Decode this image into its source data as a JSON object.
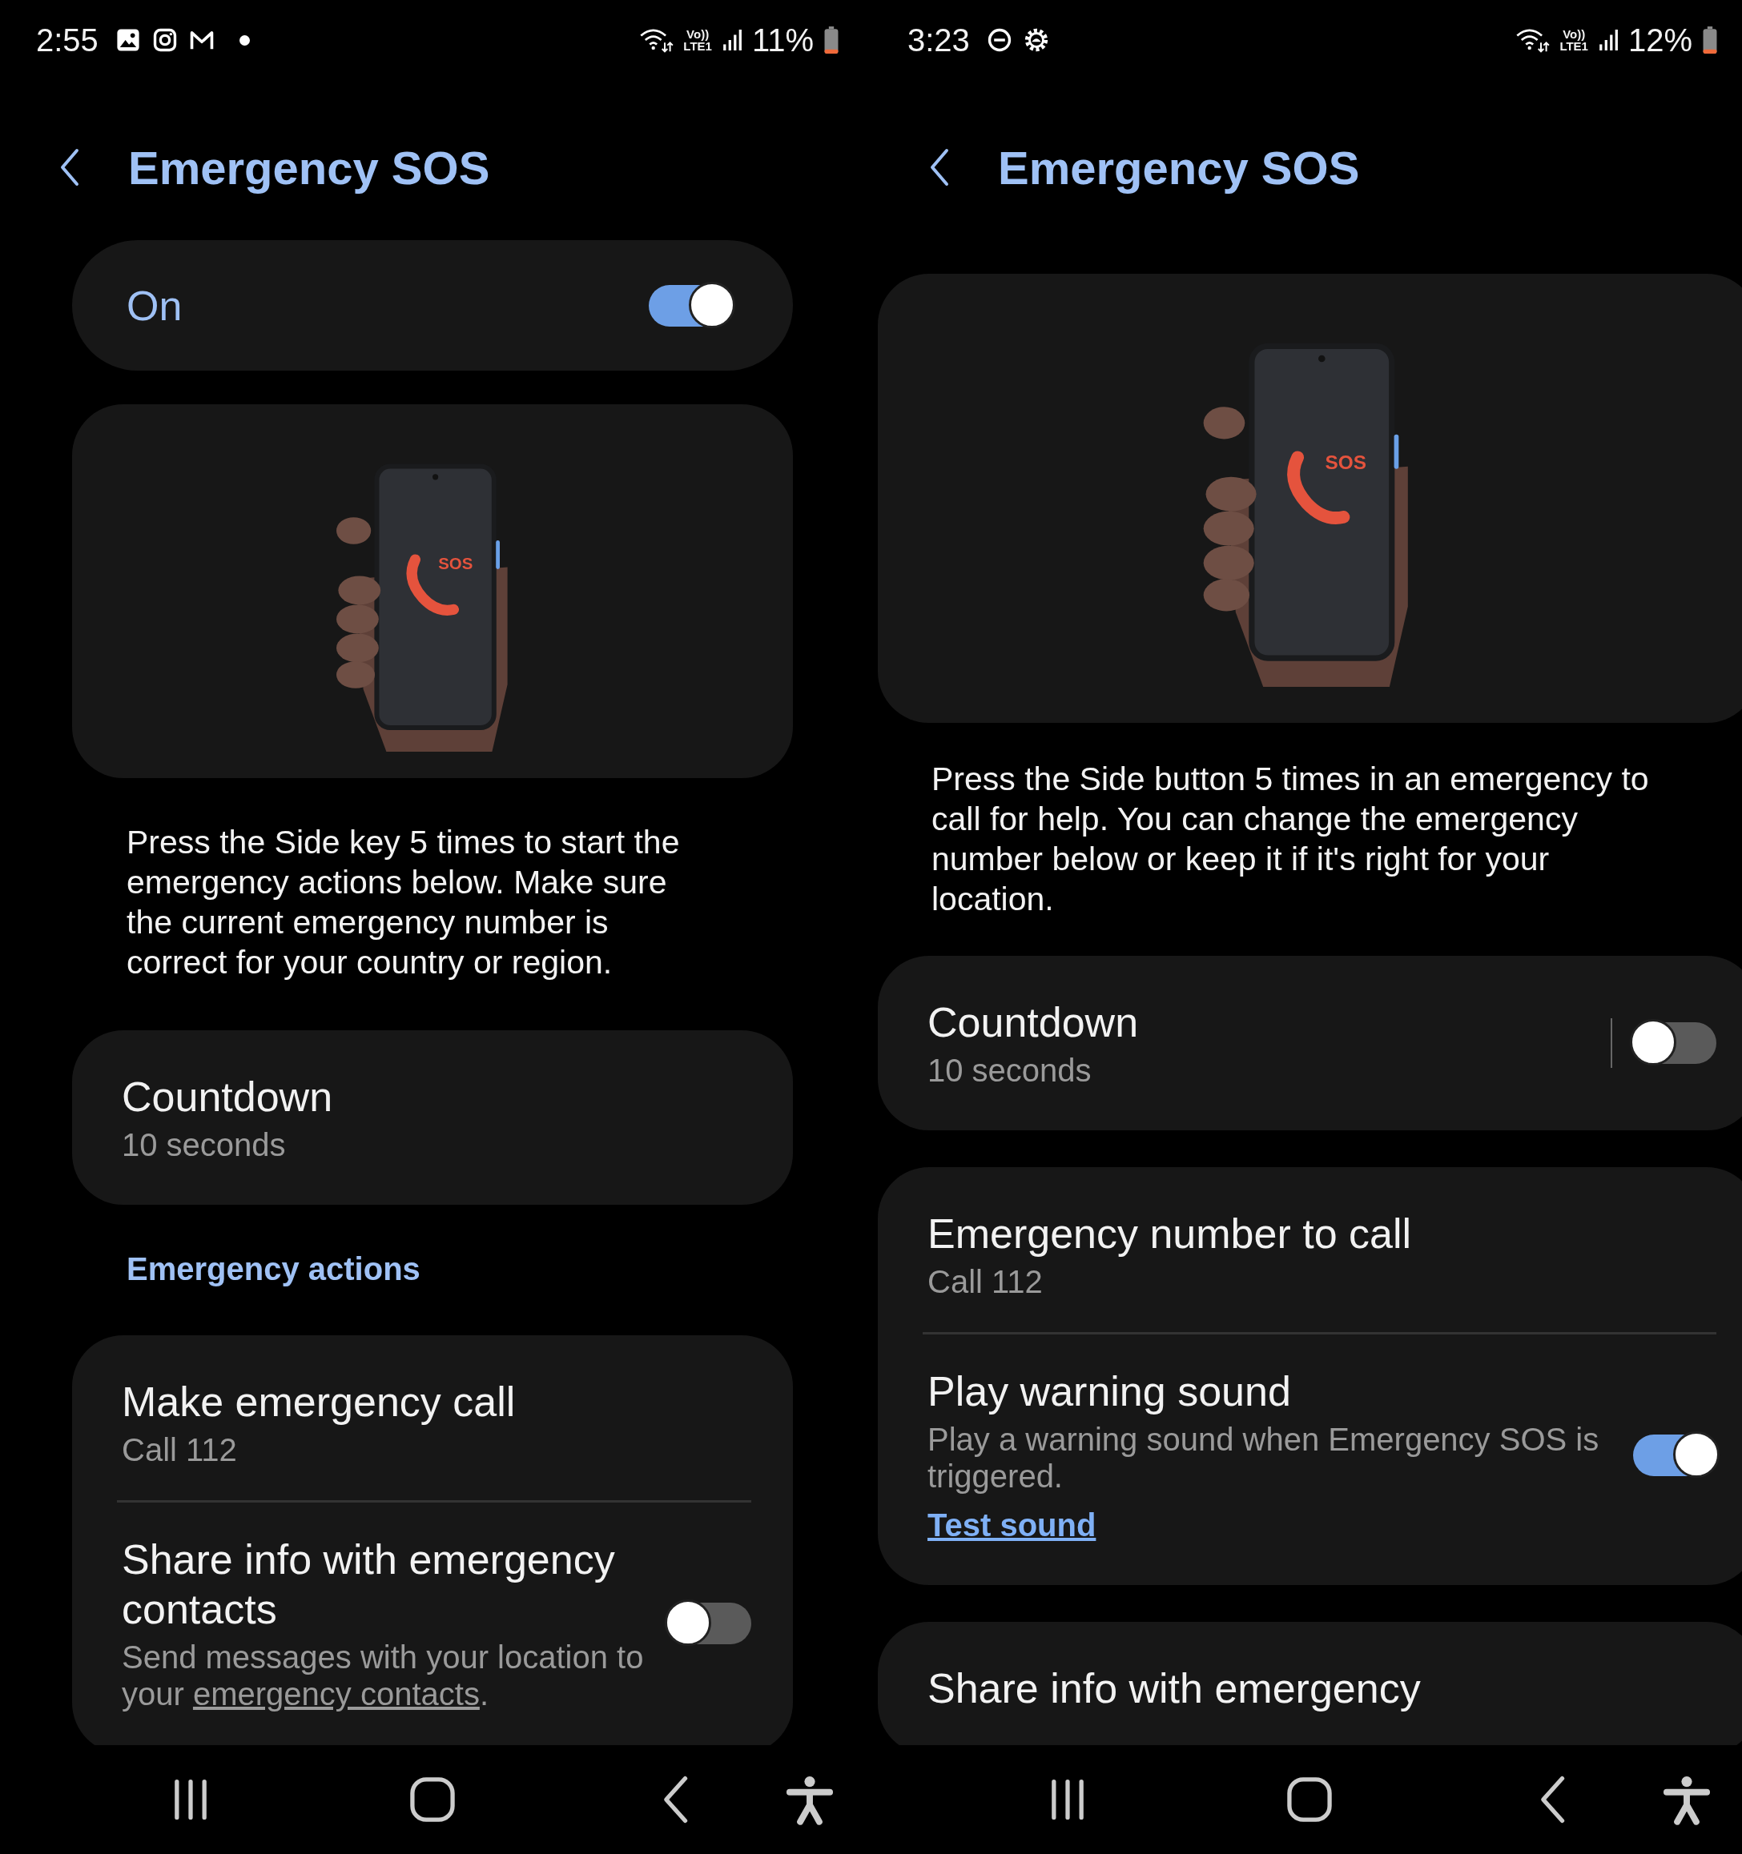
{
  "panels": [
    {
      "status_bar": {
        "time": "2:55",
        "notifications": [
          {
            "kind": "gallery"
          },
          {
            "kind": "instagram"
          },
          {
            "kind": "mail"
          },
          {
            "kind": "dot"
          }
        ],
        "volte": "Vo))",
        "network": "LTE1",
        "battery": "11%"
      },
      "title": "Emergency SOS",
      "blocks": [
        {
          "kind": "master_switch",
          "label": "On",
          "on": true
        },
        {
          "kind": "illustration",
          "badge": "SOS"
        },
        {
          "kind": "description",
          "text": "Press the Side key 5 times to start the emergency actions below. Make sure the current emergency number is correct for your country or region."
        },
        {
          "kind": "card",
          "rows": [
            {
              "title": "Countdown",
              "subtitle": "10 seconds"
            }
          ]
        },
        {
          "kind": "section_header",
          "text": "Emergency actions"
        },
        {
          "kind": "card",
          "rows": [
            {
              "title": "Make emergency call",
              "subtitle": "Call 112"
            },
            {
              "title": "Share info with emergency contacts",
              "subtitle_parts": [
                {
                  "text": "Send messages with your location to your "
                },
                {
                  "text": "emergency contacts",
                  "link": true
                },
                {
                  "text": "."
                }
              ],
              "on": false
            }
          ]
        }
      ]
    },
    {
      "status_bar": {
        "time": "3:23",
        "notifications": [
          {
            "kind": "dnd"
          },
          {
            "kind": "gear"
          }
        ],
        "volte": "Vo))",
        "network": "LTE1",
        "battery": "12%"
      },
      "title": "Emergency SOS",
      "blocks": [
        {
          "kind": "illustration",
          "badge": "SOS"
        },
        {
          "kind": "description",
          "text": "Press the Side button 5 times in an emergency to call for help. You can change the emergency number below or keep it if it's right for your location."
        },
        {
          "kind": "card",
          "rows": [
            {
              "title": "Countdown",
              "subtitle": "10 seconds",
              "on": false,
              "separator": true
            }
          ]
        },
        {
          "kind": "card",
          "rows": [
            {
              "title": "Emergency number to call",
              "subtitle": "Call 112"
            },
            {
              "title": "Play warning sound",
              "subtitle_parts": [
                {
                  "text": "Play a warning sound when Emergency SOS is triggered."
                }
              ],
              "link": "Test sound",
              "on": true
            }
          ]
        },
        {
          "kind": "card",
          "rows": [
            {
              "title": "Share info with emergency"
            }
          ]
        }
      ]
    }
  ]
}
